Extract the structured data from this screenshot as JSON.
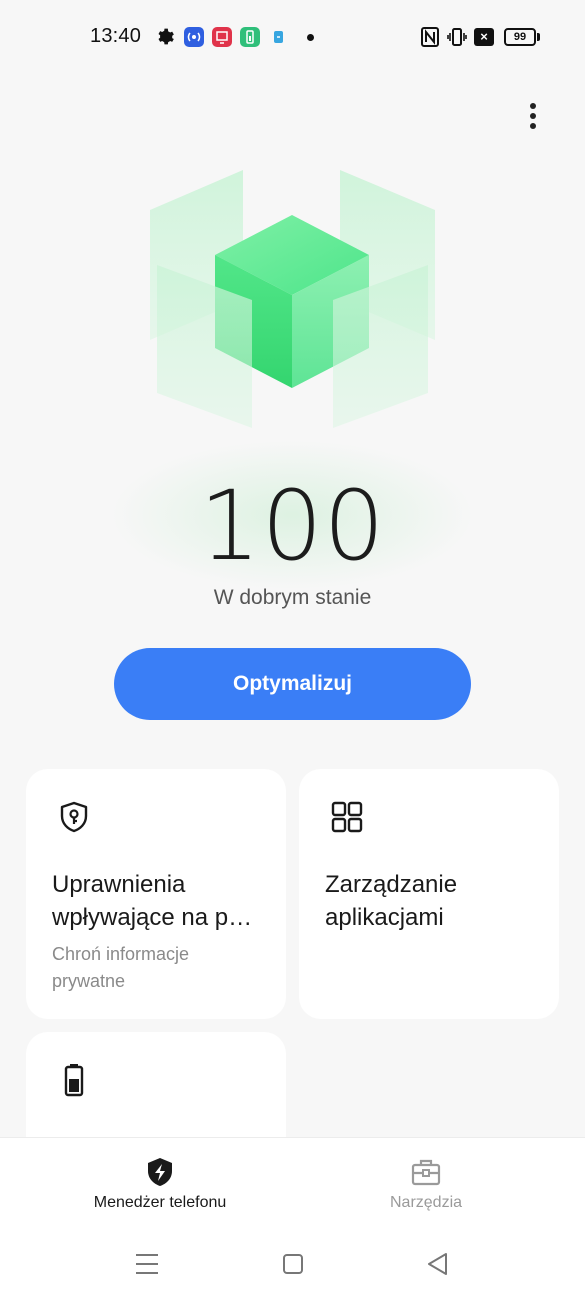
{
  "status_bar": {
    "time": "13:40",
    "icons": [
      "gear-icon",
      "hotspot-app-icon",
      "screen-app-icon",
      "battery-app-icon",
      "clone-app-icon",
      "notification-dot-icon",
      "nfc-icon",
      "vibrate-icon",
      "no-sim-icon",
      "battery-icon"
    ],
    "no_sim_glyph": "×",
    "battery_level": "99"
  },
  "toolbar": {
    "more_icon": "more-vertical-icon"
  },
  "health": {
    "score": "100",
    "status": "W dobrym stanie",
    "hero_color": "#3ddc7a"
  },
  "optimize_button": {
    "label": "Optymalizuj",
    "color": "#3a7ef6"
  },
  "cards": [
    {
      "icon": "shield-key-icon",
      "title": "Uprawnienia wpływające na p…",
      "subtitle": "Chroń informacje prywatne"
    },
    {
      "icon": "apps-grid-icon",
      "title": "Zarządzanie aplikacjami",
      "subtitle": ""
    },
    {
      "icon": "battery-icon",
      "title": "",
      "subtitle": ""
    }
  ],
  "tabs": [
    {
      "icon": "shield-bolt-icon",
      "label": "Menedżer telefonu",
      "active": true
    },
    {
      "icon": "toolbox-icon",
      "label": "Narzędzia",
      "active": false
    }
  ],
  "system_nav": [
    "menu-icon",
    "home-icon",
    "back-icon"
  ]
}
